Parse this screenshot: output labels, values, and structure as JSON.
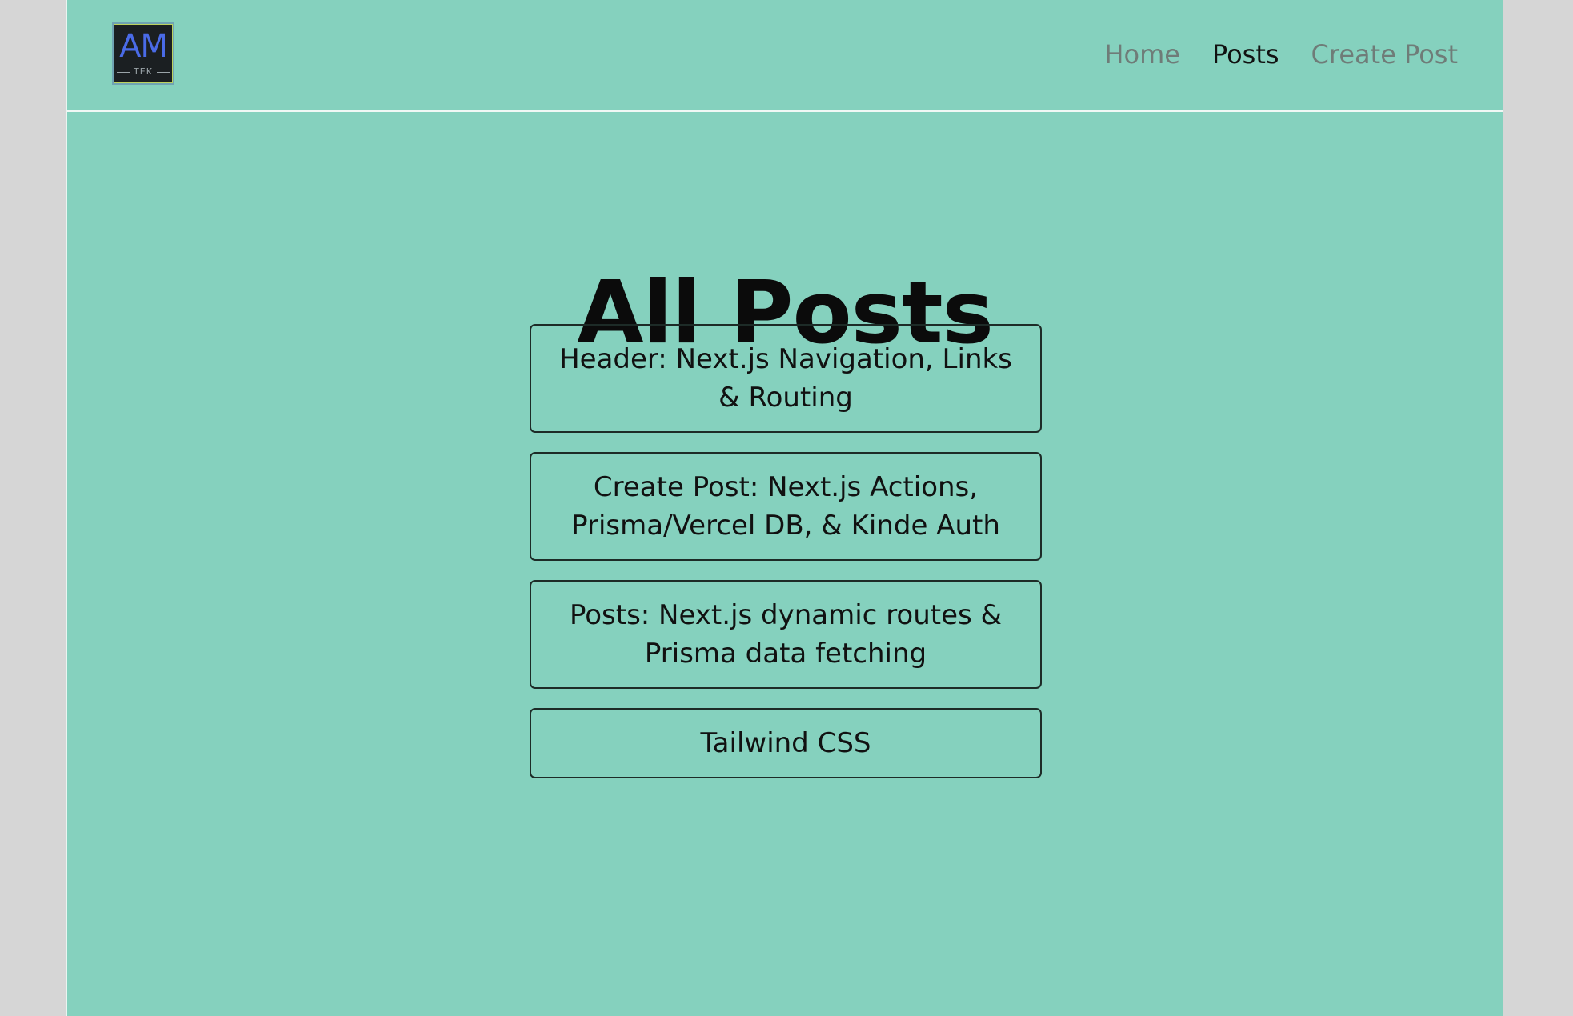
{
  "colors": {
    "page_background": "#d6d6d6",
    "content_background": "#85d1be",
    "nav_inactive": "#6f7c78",
    "nav_active": "#111111",
    "logo_accent": "#4a6be8"
  },
  "logo": {
    "main": "AM",
    "sub": "TEK"
  },
  "nav": {
    "items": [
      {
        "label": "Home",
        "active": false
      },
      {
        "label": "Posts",
        "active": true
      },
      {
        "label": "Create Post",
        "active": false
      }
    ]
  },
  "main": {
    "title": "All Posts",
    "posts": [
      {
        "title": "Header: Next.js Navigation, Links & Routing"
      },
      {
        "title": "Create Post: Next.js Actions, Prisma/Vercel DB, & Kinde Auth"
      },
      {
        "title": "Posts: Next.js dynamic routes & Prisma data fetching"
      },
      {
        "title": "Tailwind CSS"
      }
    ]
  }
}
